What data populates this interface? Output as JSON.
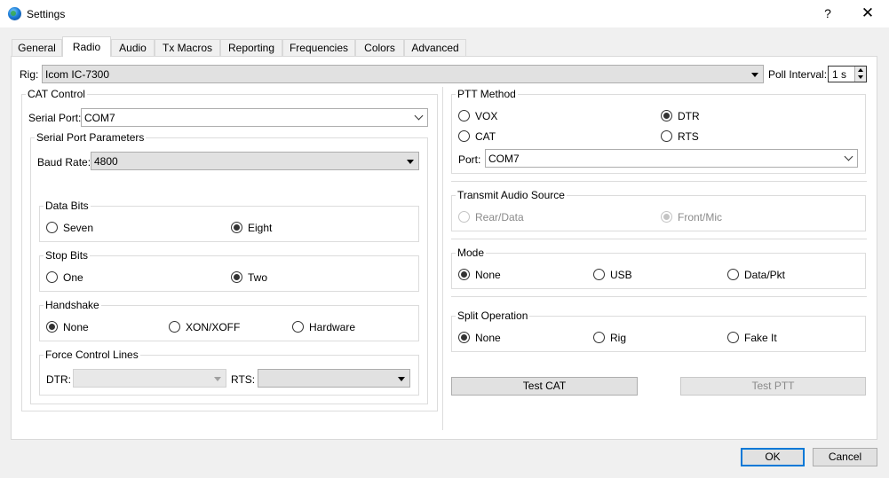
{
  "window": {
    "title": "Settings",
    "help_label": "?",
    "close_label": "✕"
  },
  "tabs": [
    {
      "label": "General"
    },
    {
      "label": "Radio"
    },
    {
      "label": "Audio"
    },
    {
      "label": "Tx Macros"
    },
    {
      "label": "Reporting"
    },
    {
      "label": "Frequencies"
    },
    {
      "label": "Colors"
    },
    {
      "label": "Advanced"
    }
  ],
  "active_tab": "Radio",
  "rig": {
    "label": "Rig:",
    "value": "Icom IC-7300",
    "poll_label": "Poll Interval:",
    "poll_value": "1 s"
  },
  "cat": {
    "title": "CAT Control",
    "serial_port_label": "Serial Port:",
    "serial_port_value": "COM7",
    "params_title": "Serial Port Parameters",
    "baud_label": "Baud Rate:",
    "baud_value": "4800",
    "data_bits": {
      "title": "Data Bits",
      "options": [
        "Seven",
        "Eight"
      ],
      "selected": "Eight"
    },
    "stop_bits": {
      "title": "Stop Bits",
      "options": [
        "One",
        "Two"
      ],
      "selected": "Two"
    },
    "handshake": {
      "title": "Handshake",
      "options": [
        "None",
        "XON/XOFF",
        "Hardware"
      ],
      "selected": "None"
    },
    "force": {
      "title": "Force Control Lines",
      "dtr_label": "DTR:",
      "rts_label": "RTS:",
      "dtr_value": "",
      "rts_value": ""
    }
  },
  "ptt": {
    "title": "PTT Method",
    "options": [
      "VOX",
      "DTR",
      "CAT",
      "RTS"
    ],
    "selected": "DTR",
    "port_label": "Port:",
    "port_value": "COM7"
  },
  "tx_audio": {
    "title": "Transmit Audio Source",
    "options": [
      "Rear/Data",
      "Front/Mic"
    ],
    "selected": "Front/Mic",
    "disabled": true
  },
  "mode": {
    "title": "Mode",
    "options": [
      "None",
      "USB",
      "Data/Pkt"
    ],
    "selected": "None"
  },
  "split": {
    "title": "Split Operation",
    "options": [
      "None",
      "Rig",
      "Fake It"
    ],
    "selected": "None"
  },
  "buttons": {
    "test_cat": "Test CAT",
    "test_ptt": "Test PTT",
    "ok": "OK",
    "cancel": "Cancel"
  }
}
